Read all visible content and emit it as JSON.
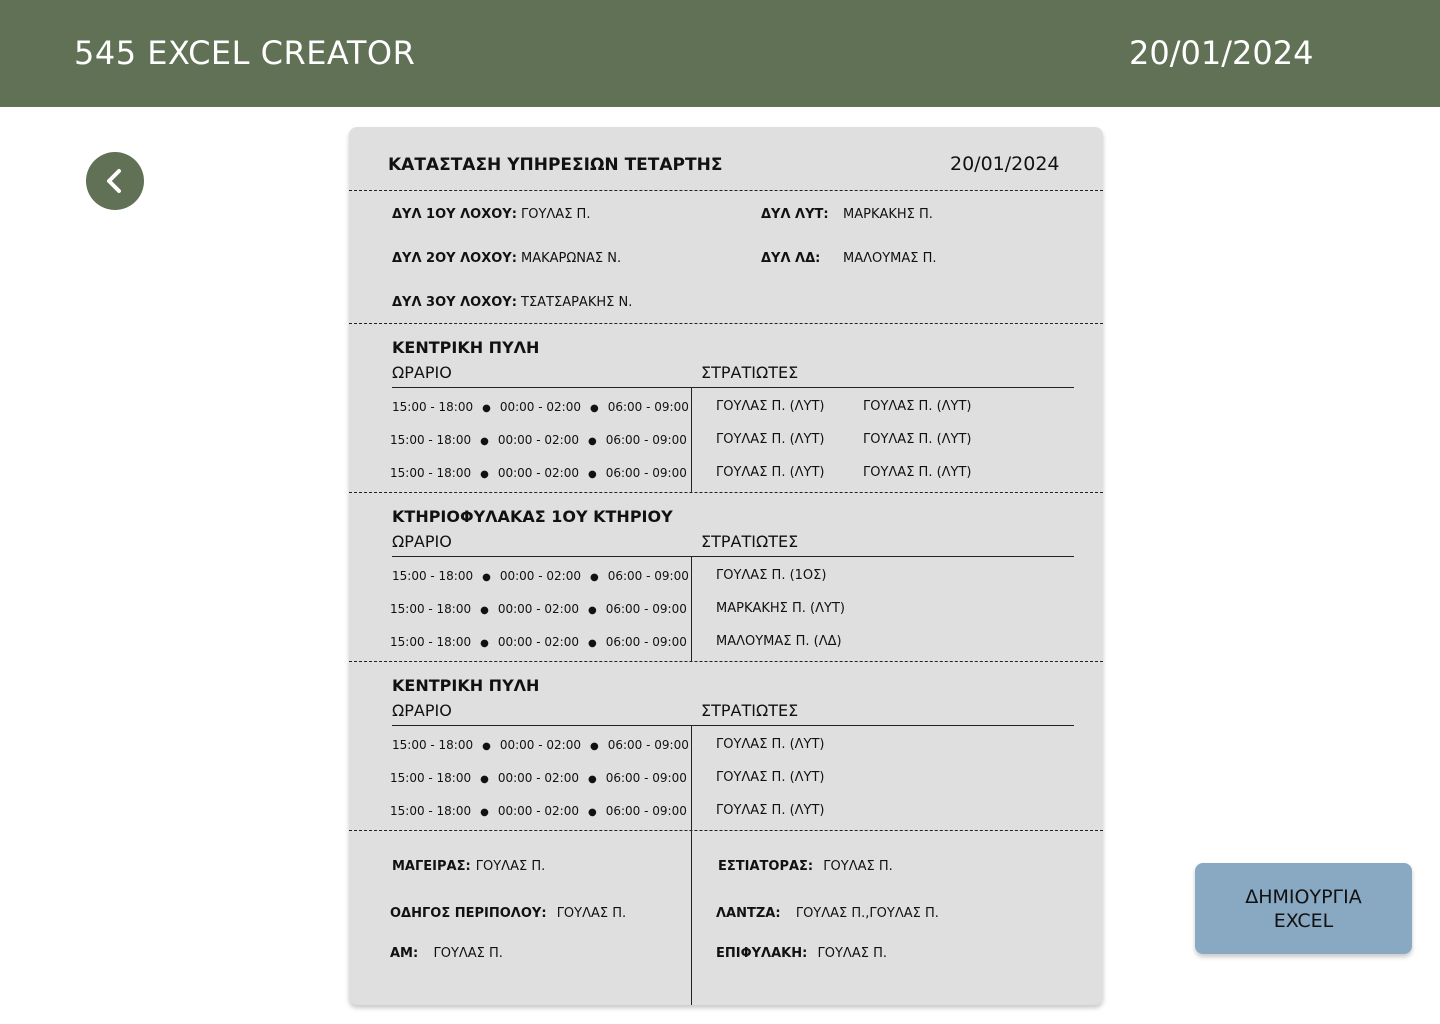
{
  "header": {
    "app_title": "545 EXCEL CREATOR",
    "date": "20/01/2024"
  },
  "back_icon": "chevron-left-icon",
  "card": {
    "title": "ΚΑΤΑΣΤΑΣΗ ΥΠΗΡΕΣΙΩΝ ΤΕΤΑΡΤΗΣ",
    "date": "20/01/2024",
    "duty": [
      {
        "label": "ΔΥΛ 1ΟΥ ΛΟΧΟΥ:",
        "value": "ΓΟΥΛΑΣ Π."
      },
      {
        "label": "ΔΥΛ 2ΟΥ ΛΟΧΟΥ:",
        "value": "ΜΑΚΑΡΩΝΑΣ Ν."
      },
      {
        "label": "ΔΥΛ 3ΟΥ ΛΟΧΟΥ:",
        "value": "ΤΣΑΤΣΑΡΑΚΗΣ Ν."
      },
      {
        "label": "ΔΥΛ ΛΥΤ:",
        "value": "ΜΑΡΚΑΚΗΣ Π."
      },
      {
        "label": "ΔΥΛ ΛΔ:",
        "value": "ΜΑΛΟΥΜΑΣ Π."
      }
    ],
    "sections": [
      {
        "title": "ΚΕΝΤΡΙΚΗ ΠΥΛΗ",
        "schedule_header": "ΩΡΑΡΙΟ",
        "soldiers_header": "ΣΤΡΑΤΙΩΤΕΣ",
        "rows": [
          {
            "t1": "15:00 - 18:00",
            "t2": "00:00 - 02:00",
            "t3": "06:00 - 09:00",
            "s1": "ΓΟΥΛΑΣ Π. (ΛΥΤ)",
            "s2": "ΓΟΥΛΑΣ Π. (ΛΥΤ)"
          },
          {
            "t1": "15:00 - 18:00",
            "t2": "00:00 - 02:00",
            "t3": "06:00 - 09:00",
            "s1": "ΓΟΥΛΑΣ Π. (ΛΥΤ)",
            "s2": "ΓΟΥΛΑΣ Π. (ΛΥΤ)"
          },
          {
            "t1": "15:00 - 18:00",
            "t2": "00:00 - 02:00",
            "t3": "06:00 - 09:00",
            "s1": "ΓΟΥΛΑΣ Π. (ΛΥΤ)",
            "s2": "ΓΟΥΛΑΣ Π. (ΛΥΤ)"
          }
        ]
      },
      {
        "title": "ΚΤΗΡΙΟΦΥΛΑΚΑΣ 1ΟΥ ΚΤΗΡΙΟΥ",
        "schedule_header": "ΩΡΑΡΙΟ",
        "soldiers_header": "ΣΤΡΑΤΙΩΤΕΣ",
        "rows": [
          {
            "t1": "15:00 - 18:00",
            "t2": "00:00 - 02:00",
            "t3": "06:00 - 09:00",
            "s1": "ΓΟΥΛΑΣ Π. (1ΟΣ)"
          },
          {
            "t1": "15:00 - 18:00",
            "t2": "00:00 - 02:00",
            "t3": "06:00 - 09:00",
            "s1": "ΜΑΡΚΑΚΗΣ Π. (ΛΥΤ)"
          },
          {
            "t1": "15:00 - 18:00",
            "t2": "00:00 - 02:00",
            "t3": "06:00 - 09:00",
            "s1": "ΜΑΛΟΥΜΑΣ Π. (ΛΔ)"
          }
        ]
      },
      {
        "title": "ΚΕΝΤΡΙΚΗ ΠΥΛΗ",
        "schedule_header": "ΩΡΑΡΙΟ",
        "soldiers_header": "ΣΤΡΑΤΙΩΤΕΣ",
        "rows": [
          {
            "t1": "15:00 - 18:00",
            "t2": "00:00 - 02:00",
            "t3": "06:00 - 09:00",
            "s1": "ΓΟΥΛΑΣ Π. (ΛΥΤ)"
          },
          {
            "t1": "15:00 - 18:00",
            "t2": "00:00 - 02:00",
            "t3": "06:00 - 09:00",
            "s1": "ΓΟΥΛΑΣ Π. (ΛΥΤ)"
          },
          {
            "t1": "15:00 - 18:00",
            "t2": "00:00 - 02:00",
            "t3": "06:00 - 09:00",
            "s1": "ΓΟΥΛΑΣ Π. (ΛΥΤ)"
          }
        ]
      }
    ],
    "footer": {
      "cook": {
        "label": "ΜΑΓΕΙΡΑΣ:",
        "value": "ΓΟΥΛΑΣ Π."
      },
      "patrol_driver": {
        "label": "ΟΔΗΓΟΣ ΠΕΡΙΠΟΛΟΥ:",
        "value": "ΓΟΥΛΑΣ Π."
      },
      "am": {
        "label": "ΑΜ:",
        "value": "ΓΟΥΛΑΣ Π."
      },
      "waiter": {
        "label": "ΕΣΤΙΑΤΟΡΑΣ:",
        "value": "ΓΟΥΛΑΣ Π."
      },
      "lantza": {
        "label": "ΛΑΝΤΖΑ:",
        "value": "ΓΟΥΛΑΣ Π.,ΓΟΥΛΑΣ Π."
      },
      "standby_guard": {
        "label": "ΕΠΙΦΥΛΑΚΗ:",
        "value": "ΓΟΥΛΑΣ Π."
      }
    }
  },
  "excel_button": {
    "line1": "ΔΗΜΙΟΥΡΓΙΑ",
    "line2": "EXCEL"
  },
  "colors": {
    "header": "#617155",
    "card": "#dfdfdf",
    "button": "#89a9c3"
  }
}
